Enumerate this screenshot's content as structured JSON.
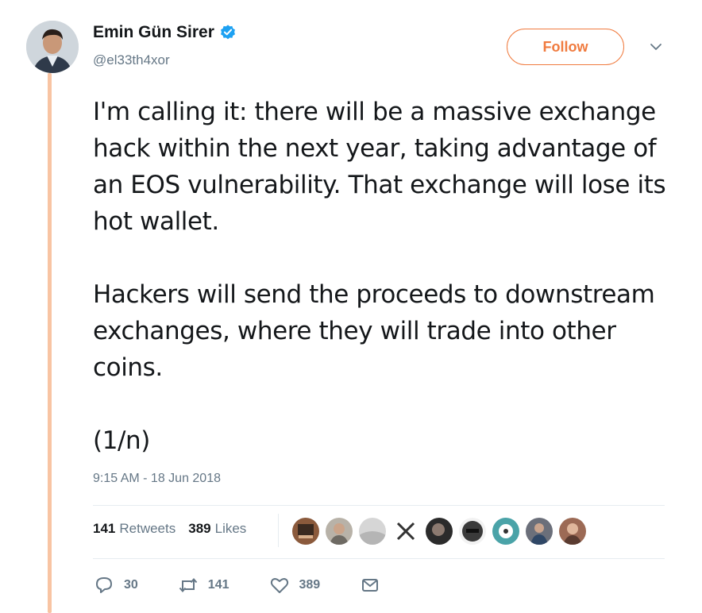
{
  "colors": {
    "accent": "#f07b3f",
    "thread_line": "#f8c4a3",
    "verified": "#1da1f2",
    "muted": "#657786"
  },
  "author": {
    "display_name": "Emin Gün Sirer",
    "handle": "@el33th4xor",
    "verified": true,
    "avatar_icon": "profile-photo"
  },
  "header": {
    "follow_label": "Follow",
    "menu_icon": "chevron-down-icon"
  },
  "tweet": {
    "paragraph_1": "I'm calling it: there will be a massive exchange hack within the next year, taking advantage of an EOS vulnerability. That exchange will lose its hot wallet.",
    "paragraph_2": "Hackers will send the proceeds to downstream exchanges, where they will trade into other coins.",
    "paragraph_3": "(1/n)",
    "timestamp": "9:15 AM - 18 Jun 2018"
  },
  "stats": {
    "retweets_count": "141",
    "retweets_label": "Retweets",
    "likes_count": "389",
    "likes_label": "Likes"
  },
  "likers": [
    {
      "icon": "liker-avatar",
      "color": "#8b5a3c"
    },
    {
      "icon": "liker-avatar",
      "color": "#a9a39a"
    },
    {
      "icon": "liker-avatar",
      "color": "#c8c8c8"
    },
    {
      "icon": "liker-avatar-logo",
      "color": "#ffffff"
    },
    {
      "icon": "liker-avatar",
      "color": "#2b2b2b"
    },
    {
      "icon": "liker-avatar",
      "color": "#3a3a3a"
    },
    {
      "icon": "liker-avatar",
      "color": "#4aa3a8"
    },
    {
      "icon": "liker-avatar",
      "color": "#6b6f7a"
    },
    {
      "icon": "liker-avatar",
      "color": "#9c6a55"
    }
  ],
  "actions": {
    "reply_count": "30",
    "reply_icon": "reply-icon",
    "retweet_count": "141",
    "retweet_icon": "retweet-icon",
    "like_count": "389",
    "like_icon": "heart-icon",
    "dm_icon": "mail-icon"
  }
}
